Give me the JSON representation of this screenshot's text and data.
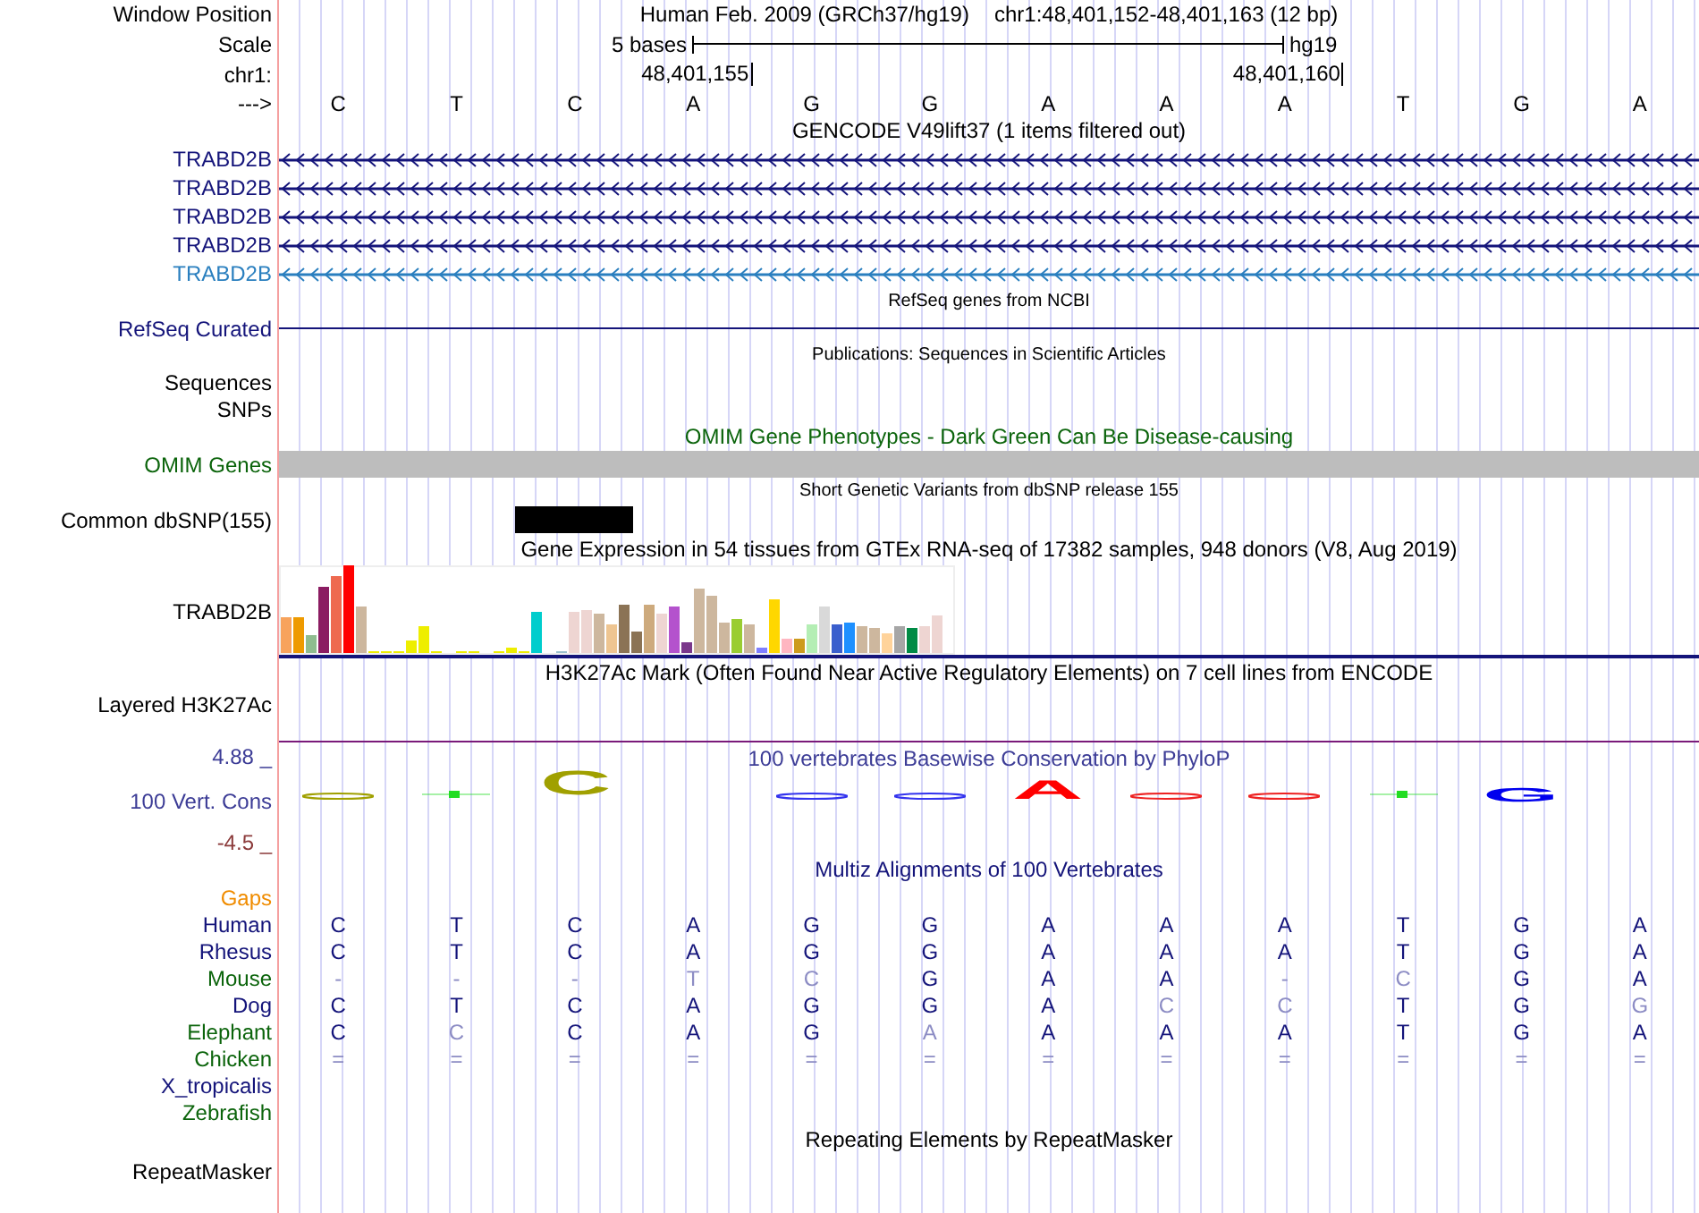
{
  "header": {
    "label": "Window Position",
    "assembly": "Human Feb. 2009 (GRCh37/hg19)",
    "position": "chr1:48,401,152-48,401,163 (12 bp)"
  },
  "scale": {
    "label": "Scale",
    "ruler": "5 bases",
    "assembly": "hg19"
  },
  "coordinates": {
    "label": "chr1:",
    "ticks": [
      "48,401,155",
      "48,401,160"
    ]
  },
  "strand": {
    "label": "--->",
    "bases": [
      "C",
      "T",
      "C",
      "A",
      "G",
      "G",
      "A",
      "A",
      "A",
      "T",
      "G",
      "A"
    ]
  },
  "tracks": [
    {
      "kind": "title",
      "text": "GENCODE V49lift37 (1 items filtered out)",
      "color": "#000000"
    },
    {
      "kind": "gene",
      "label": "TRABD2B",
      "color": "#14147a"
    },
    {
      "kind": "gene",
      "label": "TRABD2B",
      "color": "#14147a"
    },
    {
      "kind": "gene",
      "label": "TRABD2B",
      "color": "#14147a"
    },
    {
      "kind": "gene",
      "label": "TRABD2B",
      "color": "#14147a"
    },
    {
      "kind": "gene",
      "label": "TRABD2B",
      "color": "#2a7fbf"
    },
    {
      "kind": "note",
      "text": "RefSeq genes from NCBI"
    },
    {
      "kind": "line",
      "label": "RefSeq Curated",
      "color": "#14147a"
    },
    {
      "kind": "note",
      "text": "Publications: Sequences in Scientific Articles"
    },
    {
      "kind": "label",
      "label": "Sequences",
      "color": "#000000"
    },
    {
      "kind": "label",
      "label": "SNPs",
      "color": "#000000"
    },
    {
      "kind": "title",
      "text": "OMIM Gene Phenotypes - Dark Green Can Be Disease-causing",
      "color": "#0b640b"
    },
    {
      "kind": "band",
      "label": "OMIM Genes",
      "color": "#0b640b"
    },
    {
      "kind": "note",
      "text": "Short Genetic Variants from dbSNP release 155"
    },
    {
      "kind": "variant",
      "label": "Common dbSNP(155)",
      "color": "#000000"
    },
    {
      "kind": "title",
      "text": "Gene Expression in 54 tissues from GTEx RNA-seq of 17382 samples, 948 donors (V8, Aug 2019)",
      "color": "#000000"
    },
    {
      "kind": "expression",
      "label": "TRABD2B",
      "color": "#000000"
    },
    {
      "kind": "title",
      "text": "H3K27Ac Mark (Often Found Near Active Regulatory Elements) on 7 cell lines from ENCODE",
      "color": "#000000"
    },
    {
      "kind": "empty",
      "label": "Layered H3K27Ac",
      "color": "#000000"
    },
    {
      "kind": "wiggle-top",
      "label": "4.88 _",
      "text": "100 vertebrates Basewise Conservation by PhyloP",
      "color": "#3c3c96"
    },
    {
      "kind": "logo",
      "label": "100 Vert. Cons",
      "color": "#3c3c96",
      "logo": [
        {
          "kind": "smear",
          "color": "#a0a000"
        },
        {
          "kind": "dot",
          "color": "#22dd22"
        },
        {
          "kind": "letter-large",
          "letter": "C",
          "color": "#a0a000"
        },
        {
          "kind": "blank"
        },
        {
          "kind": "smear",
          "color": "#3333ee"
        },
        {
          "kind": "smear",
          "color": "#3333ee"
        },
        {
          "kind": "letter-medium",
          "letter": "A",
          "color": "#ff0000"
        },
        {
          "kind": "smear",
          "color": "#ee2222"
        },
        {
          "kind": "smear",
          "color": "#ee2222"
        },
        {
          "kind": "dot",
          "color": "#22dd22"
        },
        {
          "kind": "letter-small",
          "letter": "G",
          "color": "#0000ee"
        },
        {
          "kind": "blank"
        }
      ]
    },
    {
      "kind": "bottom",
      "label": "-4.5 _",
      "color": "#8b3a3a"
    },
    {
      "kind": "title",
      "text": "Multiz Alignments of 100 Vertebrates",
      "color": "#14147a"
    },
    {
      "kind": "label",
      "label": "Gaps",
      "color": "#f08c00"
    },
    {
      "kind": "species",
      "label": "Human",
      "color": "#14147a",
      "bases": [
        {
          "text": "C",
          "faded": false
        },
        {
          "text": "T",
          "faded": false
        },
        {
          "text": "C",
          "faded": false
        },
        {
          "text": "A",
          "faded": false
        },
        {
          "text": "G",
          "faded": false
        },
        {
          "text": "G",
          "faded": false
        },
        {
          "text": "A",
          "faded": false
        },
        {
          "text": "A",
          "faded": false
        },
        {
          "text": "A",
          "faded": false
        },
        {
          "text": "T",
          "faded": false
        },
        {
          "text": "G",
          "faded": false
        },
        {
          "text": "A",
          "faded": false
        }
      ]
    },
    {
      "kind": "species",
      "label": "Rhesus",
      "color": "#14147a",
      "bases": [
        {
          "text": "C",
          "faded": false
        },
        {
          "text": "T",
          "faded": false
        },
        {
          "text": "C",
          "faded": false
        },
        {
          "text": "A",
          "faded": false
        },
        {
          "text": "G",
          "faded": false
        },
        {
          "text": "G",
          "faded": false
        },
        {
          "text": "A",
          "faded": false
        },
        {
          "text": "A",
          "faded": false
        },
        {
          "text": "A",
          "faded": false
        },
        {
          "text": "T",
          "faded": false
        },
        {
          "text": "G",
          "faded": false
        },
        {
          "text": "A",
          "faded": false
        }
      ]
    },
    {
      "kind": "species",
      "label": "Mouse",
      "color": "#0b640b",
      "bases": [
        {
          "text": "-",
          "faded": true
        },
        {
          "text": "-",
          "faded": true
        },
        {
          "text": "-",
          "faded": true
        },
        {
          "text": "T",
          "faded": true
        },
        {
          "text": "C",
          "faded": true
        },
        {
          "text": "G",
          "faded": false
        },
        {
          "text": "A",
          "faded": false
        },
        {
          "text": "A",
          "faded": false
        },
        {
          "text": "-",
          "faded": true
        },
        {
          "text": "C",
          "faded": true
        },
        {
          "text": "G",
          "faded": false
        },
        {
          "text": "A",
          "faded": false
        }
      ]
    },
    {
      "kind": "species",
      "label": "Dog",
      "color": "#14147a",
      "bases": [
        {
          "text": "C",
          "faded": false
        },
        {
          "text": "T",
          "faded": false
        },
        {
          "text": "C",
          "faded": false
        },
        {
          "text": "A",
          "faded": false
        },
        {
          "text": "G",
          "faded": false
        },
        {
          "text": "G",
          "faded": false
        },
        {
          "text": "A",
          "faded": false
        },
        {
          "text": "C",
          "faded": true
        },
        {
          "text": "C",
          "faded": true
        },
        {
          "text": "T",
          "faded": false
        },
        {
          "text": "G",
          "faded": false
        },
        {
          "text": "G",
          "faded": true
        }
      ]
    },
    {
      "kind": "species",
      "label": "Elephant",
      "color": "#0b640b",
      "bases": [
        {
          "text": "C",
          "faded": false
        },
        {
          "text": "C",
          "faded": true
        },
        {
          "text": "C",
          "faded": false
        },
        {
          "text": "A",
          "faded": false
        },
        {
          "text": "G",
          "faded": false
        },
        {
          "text": "A",
          "faded": true
        },
        {
          "text": "A",
          "faded": false
        },
        {
          "text": "A",
          "faded": false
        },
        {
          "text": "A",
          "faded": false
        },
        {
          "text": "T",
          "faded": false
        },
        {
          "text": "G",
          "faded": false
        },
        {
          "text": "A",
          "faded": false
        }
      ]
    },
    {
      "kind": "species",
      "label": "Chicken",
      "color": "#0b640b",
      "bases": [
        {
          "text": "=",
          "faded": true
        },
        {
          "text": "=",
          "faded": true
        },
        {
          "text": "=",
          "faded": true
        },
        {
          "text": "=",
          "faded": true
        },
        {
          "text": "=",
          "faded": true
        },
        {
          "text": "=",
          "faded": true
        },
        {
          "text": "=",
          "faded": true
        },
        {
          "text": "=",
          "faded": true
        },
        {
          "text": "=",
          "faded": true
        },
        {
          "text": "=",
          "faded": true
        },
        {
          "text": "=",
          "faded": true
        },
        {
          "text": "=",
          "faded": true
        }
      ]
    },
    {
      "kind": "species-label",
      "label": "X_tropicalis",
      "color": "#14147a"
    },
    {
      "kind": "species-label",
      "label": "Zebrafish",
      "color": "#0b640b"
    },
    {
      "kind": "title",
      "text": "Repeating Elements by RepeatMasker",
      "color": "#000000"
    },
    {
      "kind": "empty",
      "label": "RepeatMasker",
      "color": "#000000"
    }
  ]
}
